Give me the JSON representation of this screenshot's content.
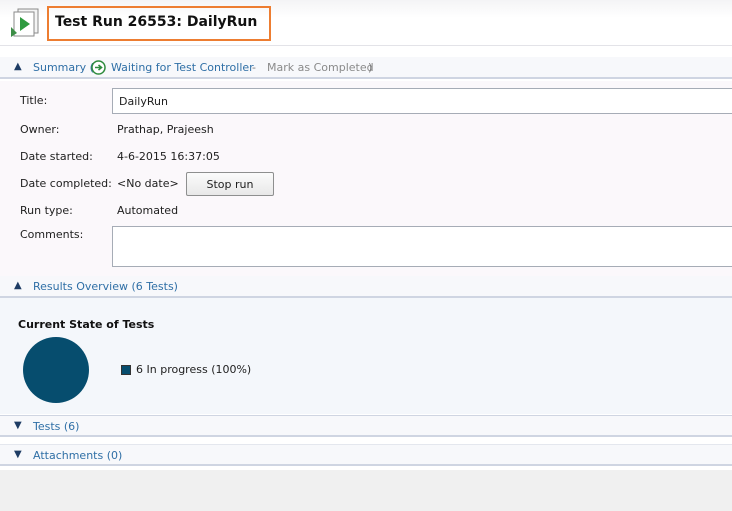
{
  "header": {
    "title": "Test Run 26553: DailyRun",
    "icon": "test-run-icon"
  },
  "summary": {
    "section_label": "Summary (",
    "status_text": "Waiting for Test Controller",
    "separator": " - ",
    "mark_completed_link": "Mark as Completed",
    "close_paren": ")",
    "fields": {
      "title_label": "Title:",
      "title_value": "DailyRun",
      "owner_label": "Owner:",
      "owner_value": "Prathap, Prajeesh",
      "date_started_label": "Date started:",
      "date_started_value": "4-6-2015 16:37:05",
      "date_completed_label": "Date completed:",
      "date_completed_value": "<No date>",
      "stop_run_label": "Stop run",
      "run_type_label": "Run type:",
      "run_type_value": "Automated",
      "comments_label": "Comments:",
      "comments_value": ""
    }
  },
  "results_overview": {
    "section_label": "Results Overview (6 Tests)",
    "chart_title": "Current State of Tests",
    "chart_data": {
      "type": "pie",
      "title": "Current State of Tests",
      "series": [
        {
          "name": "In progress",
          "value": 6,
          "percent": 100,
          "color": "#064d6e"
        }
      ],
      "legend_text": "6 In progress (100%)",
      "legend_placement": "right"
    }
  },
  "tests": {
    "section_label": "Tests (6)"
  },
  "attachments": {
    "section_label": "Attachments (0)"
  },
  "colors": {
    "accent_border": "#ed7d31",
    "link": "#2f6fa6",
    "pie": "#064d6e",
    "status_icon": "#2e8b3d"
  }
}
